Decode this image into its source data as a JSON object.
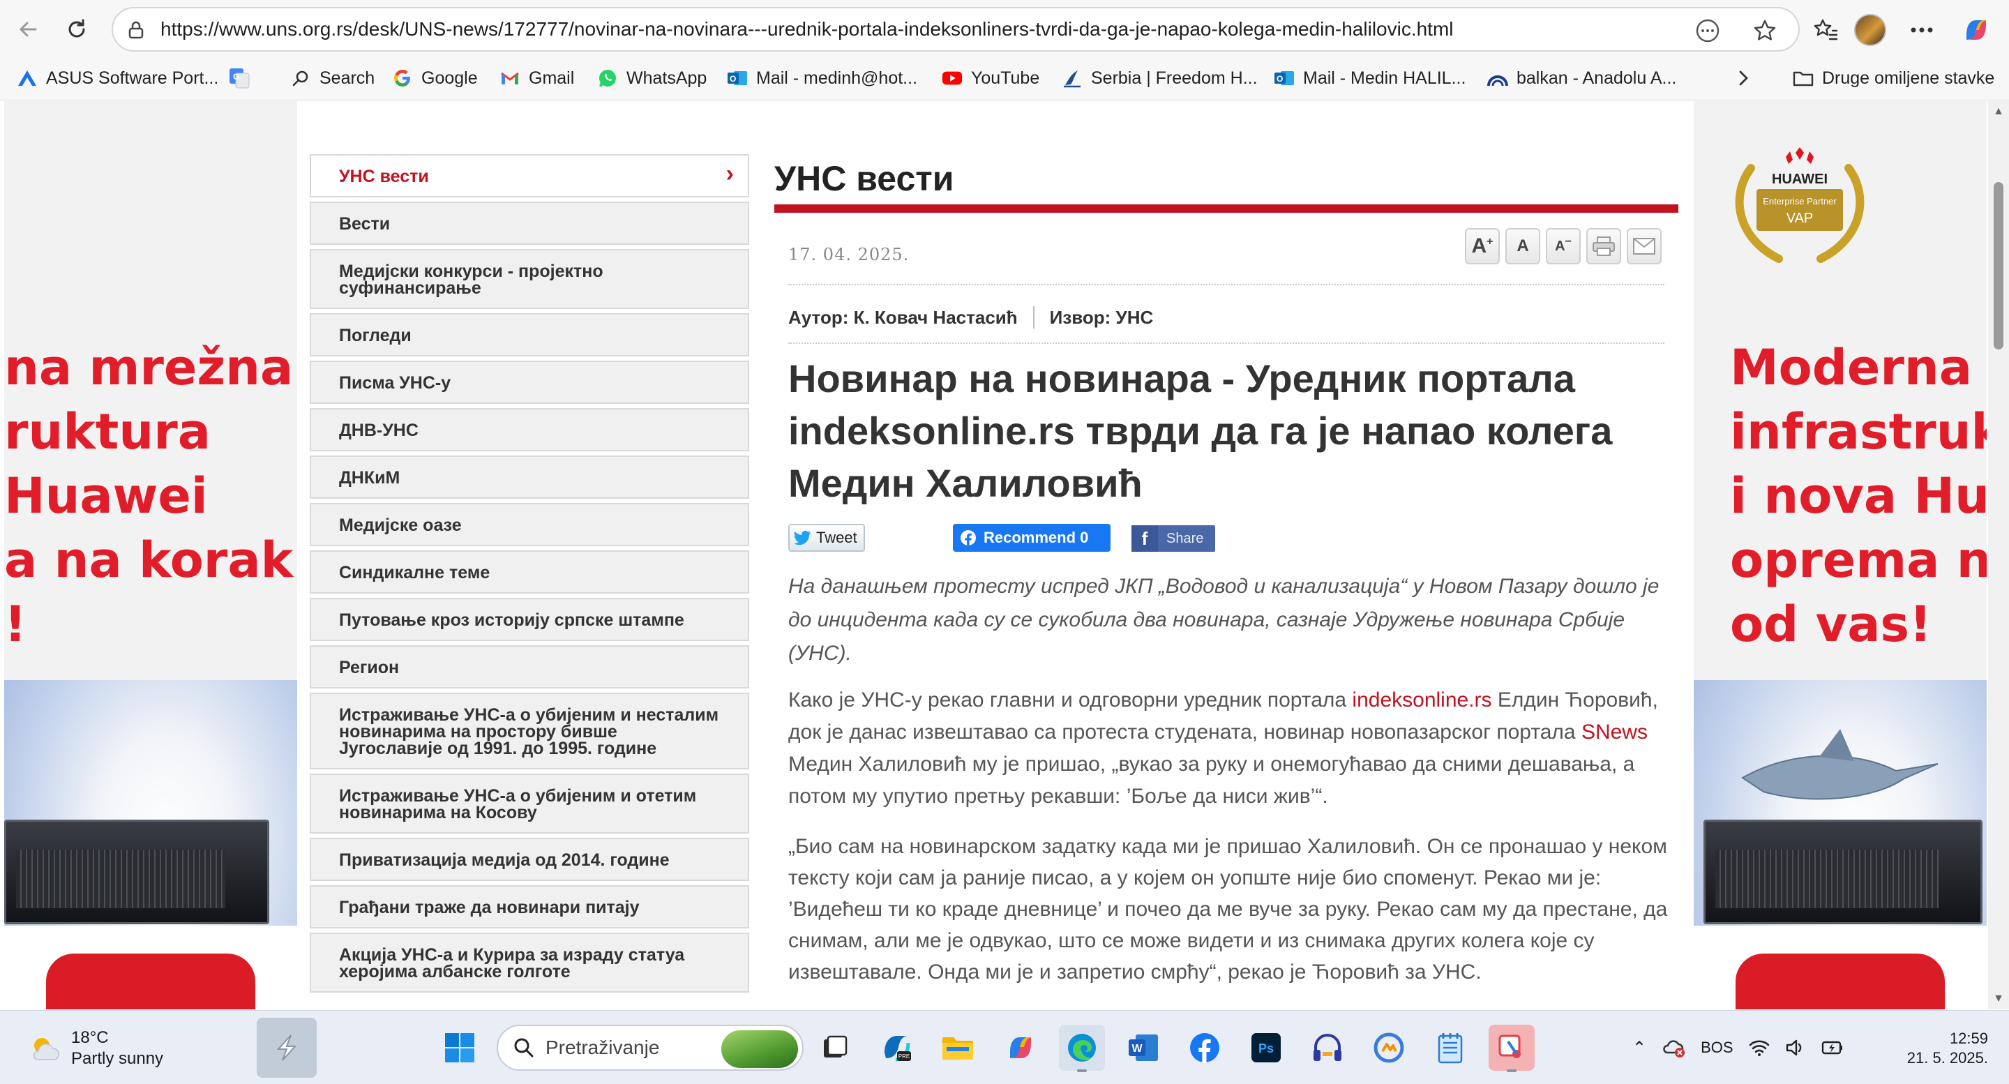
{
  "browser": {
    "url": "https://www.uns.org.rs/desk/UNS-news/172777/novinar-na-novinara---urednik-portala-indeksonliners-tvrdi-da-ga-je-napao-kolega-medin-halilovic.html",
    "bookmarks": [
      {
        "label": "ASUS Software Port...",
        "icon": "asus-icon"
      },
      {
        "label": "",
        "icon": "google-translate-icon"
      },
      {
        "label": "Search",
        "icon": "search-icon"
      },
      {
        "label": "Google",
        "icon": "google-icon"
      },
      {
        "label": "Gmail",
        "icon": "gmail-icon"
      },
      {
        "label": "WhatsApp",
        "icon": "whatsapp-icon"
      },
      {
        "label": "Mail - medinh@hot...",
        "icon": "outlook-icon"
      },
      {
        "label": "YouTube",
        "icon": "youtube-icon"
      },
      {
        "label": "Serbia | Freedom H...",
        "icon": "freedom-house-icon"
      },
      {
        "label": "Mail - Medin HALIL...",
        "icon": "outlook-icon"
      },
      {
        "label": "balkan - Anadolu A...",
        "icon": "anadolu-icon"
      }
    ],
    "other_favorites": "Druge omiljene stavke"
  },
  "ads": {
    "left_lines": [
      "na mrežna",
      "ruktura",
      " Huawei",
      "a na korak",
      "!"
    ],
    "right_lines": [
      "Moderna",
      "infrastruk",
      "i nova Hu",
      "oprema n",
      "od vas!"
    ],
    "badge": {
      "brand": "HUAWEI",
      "line1": "Enterprise Partner",
      "line2": "VAP"
    },
    "colors": {
      "ad_red": "#e11d2a"
    }
  },
  "menu": {
    "items": [
      {
        "label": "УНС вести",
        "active": true
      },
      {
        "label": "Вести"
      },
      {
        "label": "Медијски конкурси - пројектно суфинансирање"
      },
      {
        "label": "Погледи"
      },
      {
        "label": "Писма УНС-у"
      },
      {
        "label": "ДНВ-УНС"
      },
      {
        "label": "ДНКиМ"
      },
      {
        "label": "Медијске оазе"
      },
      {
        "label": "Синдикалне теме"
      },
      {
        "label": "Путовање кроз историју српске штампе"
      },
      {
        "label": "Регион"
      },
      {
        "label": "Истраживање УНС-а о убијеним и несталим новинарима на простору бивше Југославије од 1991. до 1995. године"
      },
      {
        "label": "Истраживање УНС-а о убијеним и отетим новинарима на Косову"
      },
      {
        "label": "Приватизација медија од 2014. године"
      },
      {
        "label": "Грађани траже да новинари питају"
      },
      {
        "label": "Акција УНС-а и Курира за израду статуа херојима албанске голготе"
      }
    ]
  },
  "article": {
    "section_title": "УНС вести",
    "date": "17. 04. 2025.",
    "author": "Аутор: К. Ковач Настасић",
    "source": "Извор: УНС",
    "tools": {
      "increase": "A",
      "normal": "A",
      "decrease": "A"
    },
    "headline": "Новинар на новинара - Уредник портала indeksonline.rs тврди да га је напао колега Медин Халиловић",
    "share": {
      "tweet": "Tweet",
      "recommend": "Recommend 0",
      "fb_share": "Share"
    },
    "lede": "На данашњем протесту испред ЈКП „Водовод и канализација“ у Новом Пазару дошло је до инцидента када су се сукобила два новинара, сазнаје Удружење новинара Србије (УНС).",
    "body1": {
      "part1": "Како је УНС-у рекао главни и одговорни уредник портала ",
      "link1": "indeksonline.rs",
      "part2": " Елдин Ћоровић, док је данас извештавао са протеста студената, новинар новопазарског портала ",
      "link2": "SNews",
      "part3": " Медин Халиловић му је пришао, „вукао за руку и онемогућавао да сними дешавања, а потом му упутио претњу рекавши: ’Боље да ниси жив’“."
    },
    "body2": "„Био сам на новинарском задатку када ми је пришао Халиловић. Он се пронашао у неком тексту који сам ја раније писао, а у којем он уопште није био споменут. Рекао ми је: ’Видећеш ти ко краде дневнице’ и почео да ме вуче за руку. Рекао сам му да престане, да снимам, али ме је одвукао, што се може видети и из снимака других колега које су извештавале. Онда ми је и запретио смрћу“, рекао је Ћоровић за УНС.",
    "colors": {
      "accent": "#c1121f"
    }
  },
  "taskbar": {
    "weather_temp": "18°C",
    "weather_desc": "Partly sunny",
    "search_placeholder": "Pretraživanje",
    "language": "BOS",
    "time": "12:59",
    "date": "21. 5. 2025."
  }
}
